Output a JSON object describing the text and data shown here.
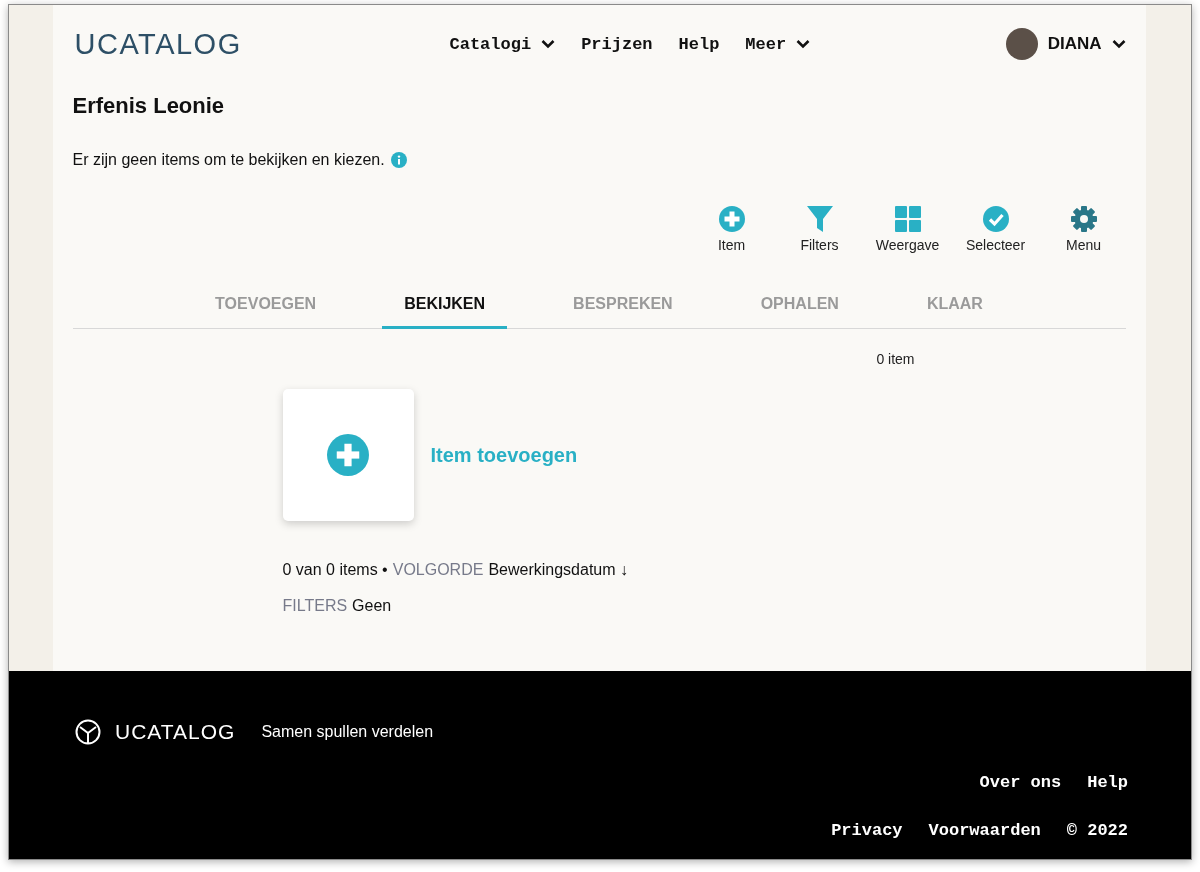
{
  "header": {
    "logo": "UCATALOG",
    "nav": [
      {
        "label": "Catalogi",
        "has_menu": true
      },
      {
        "label": "Prijzen",
        "has_menu": false
      },
      {
        "label": "Help",
        "has_menu": false
      },
      {
        "label": "Meer",
        "has_menu": true
      }
    ],
    "user": {
      "name": "DIANA"
    }
  },
  "page": {
    "title": "Erfenis Leonie",
    "info": "Er zijn geen items om te bekijken en kiezen."
  },
  "toolbar": [
    {
      "kind": "add",
      "label": "Item"
    },
    {
      "kind": "filter",
      "label": "Filters"
    },
    {
      "kind": "grid",
      "label": "Weergave"
    },
    {
      "kind": "check",
      "label": "Selecteer"
    },
    {
      "kind": "gear",
      "label": "Menu"
    }
  ],
  "tabs": [
    {
      "label": "TOEVOEGEN",
      "selected": false
    },
    {
      "label": "BEKIJKEN",
      "selected": true
    },
    {
      "label": "BESPREKEN",
      "selected": false
    },
    {
      "label": "OPHALEN",
      "selected": false
    },
    {
      "label": "KLAAR",
      "selected": false
    }
  ],
  "item_count": "0 item",
  "add_card": {
    "label": "Item toevoegen"
  },
  "summary": {
    "count": "0 van 0 items •",
    "order_label": "VOLGORDE",
    "order_value": "Bewerkingsdatum ↓",
    "filters_label": "FILTERS",
    "filters_value": "Geen"
  },
  "footer": {
    "logo": "UCATALOG",
    "tagline": "Samen spullen verdelen",
    "link_rows": [
      [
        "Over ons",
        "Help"
      ],
      [
        "Privacy",
        "Voorwaarden",
        "© 2022"
      ]
    ]
  }
}
